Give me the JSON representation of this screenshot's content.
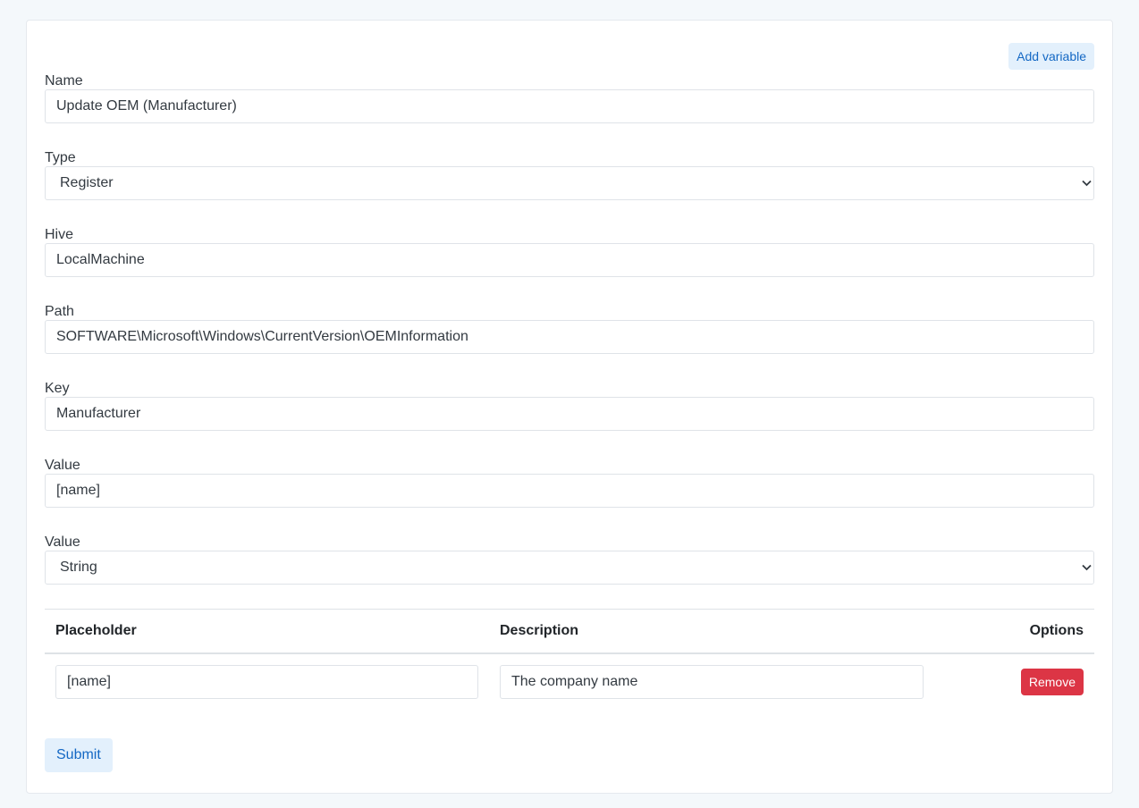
{
  "toolbar": {
    "add_variable_label": "Add variable"
  },
  "form": {
    "name": {
      "label": "Name",
      "value": "Update OEM (Manufacturer)"
    },
    "type": {
      "label": "Type",
      "value": "Register"
    },
    "hive": {
      "label": "Hive",
      "value": "LocalMachine"
    },
    "path": {
      "label": "Path",
      "value": "SOFTWARE\\Microsoft\\Windows\\CurrentVersion\\OEMInformation"
    },
    "key": {
      "label": "Key",
      "value": "Manufacturer"
    },
    "value": {
      "label": "Value",
      "value": "[name]"
    },
    "value_type": {
      "label": "Value",
      "value": "String"
    }
  },
  "variables_table": {
    "headers": {
      "placeholder": "Placeholder",
      "description": "Description",
      "options": "Options"
    },
    "rows": [
      {
        "placeholder": "[name]",
        "description": "The company name",
        "remove_label": "Remove"
      }
    ]
  },
  "submit_label": "Submit",
  "icons": {
    "select_arrow": "chevron-down-icon"
  },
  "colors": {
    "primary_soft": "#e3f0fc",
    "primary_text": "#1468c4",
    "danger": "#dc3545"
  }
}
